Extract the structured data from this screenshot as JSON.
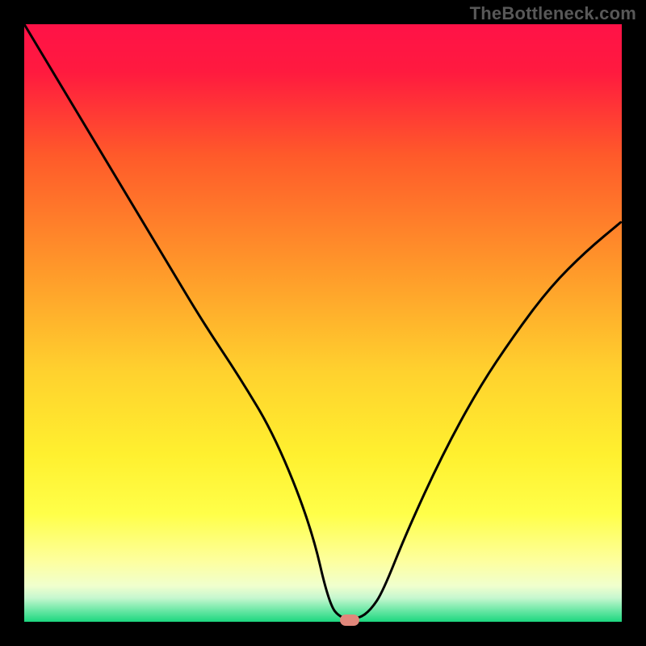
{
  "watermark": "TheBottleneck.com",
  "chart_data": {
    "type": "line",
    "title": "",
    "xlabel": "",
    "ylabel": "",
    "xlim": [
      0,
      100
    ],
    "ylim": [
      0,
      100
    ],
    "grid": false,
    "legend": false,
    "series": [
      {
        "name": "bottleneck-curve",
        "x": [
          0,
          6,
          12,
          18,
          24,
          30,
          36,
          42,
          48,
          51,
          53,
          56,
          58,
          60,
          64,
          70,
          76,
          82,
          88,
          94,
          100
        ],
        "y": [
          100,
          90,
          80,
          70,
          60,
          50,
          41,
          31,
          16,
          3,
          0.5,
          0.5,
          2,
          5,
          15,
          28,
          39,
          48,
          56,
          62,
          67
        ]
      }
    ],
    "marker": {
      "x": 54.5,
      "y": 0,
      "color": "#e1877b"
    },
    "gradient_stops": [
      {
        "pct": 0,
        "color": "#ff1247"
      },
      {
        "pct": 8,
        "color": "#ff1a3f"
      },
      {
        "pct": 22,
        "color": "#ff5a2a"
      },
      {
        "pct": 40,
        "color": "#ff952a"
      },
      {
        "pct": 58,
        "color": "#ffd12e"
      },
      {
        "pct": 72,
        "color": "#fff02f"
      },
      {
        "pct": 82,
        "color": "#ffff49"
      },
      {
        "pct": 90,
        "color": "#fdffa0"
      },
      {
        "pct": 94,
        "color": "#f0ffce"
      },
      {
        "pct": 96,
        "color": "#c6f7cf"
      },
      {
        "pct": 98,
        "color": "#6fe8a7"
      },
      {
        "pct": 100,
        "color": "#1cd77f"
      }
    ]
  }
}
